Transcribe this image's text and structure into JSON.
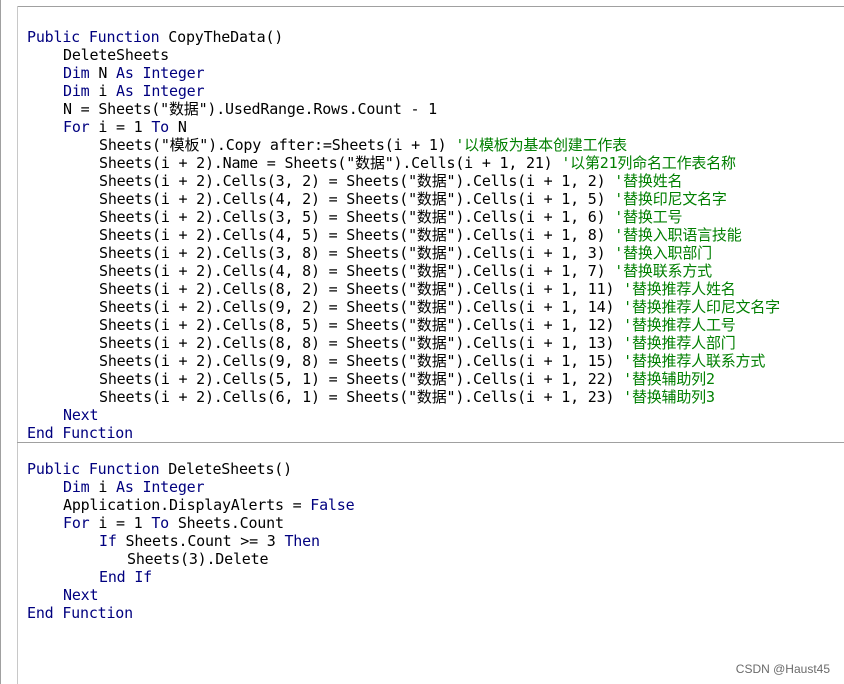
{
  "editor": {
    "procedures": [
      {
        "lines": [
          {
            "indent": 0,
            "segments": [
              {
                "t": "Public Function",
                "k": "kw"
              },
              {
                "t": " CopyTheData()",
                "k": "tx"
              }
            ]
          },
          {
            "indent": 1,
            "segments": [
              {
                "t": "DeleteSheets",
                "k": "tx"
              }
            ]
          },
          {
            "indent": 1,
            "segments": [
              {
                "t": "Dim",
                "k": "kw"
              },
              {
                "t": " N ",
                "k": "tx"
              },
              {
                "t": "As Integer",
                "k": "kw"
              }
            ]
          },
          {
            "indent": 1,
            "segments": [
              {
                "t": "Dim",
                "k": "kw"
              },
              {
                "t": " i ",
                "k": "tx"
              },
              {
                "t": "As Integer",
                "k": "kw"
              }
            ]
          },
          {
            "indent": 1,
            "segments": [
              {
                "t": "N = Sheets(\"数据\").UsedRange.Rows.Count - 1",
                "k": "tx"
              }
            ]
          },
          {
            "indent": 1,
            "segments": [
              {
                "t": "For",
                "k": "kw"
              },
              {
                "t": " i = 1 ",
                "k": "tx"
              },
              {
                "t": "To",
                "k": "kw"
              },
              {
                "t": " N",
                "k": "tx"
              }
            ]
          },
          {
            "indent": 2,
            "segments": [
              {
                "t": "Sheets(\"模板\").Copy after:=Sheets(i + 1) ",
                "k": "tx"
              },
              {
                "t": "'以模板为基本创建工作表",
                "k": "cm"
              }
            ]
          },
          {
            "indent": 2,
            "segments": [
              {
                "t": "Sheets(i + 2).Name = Sheets(\"数据\").Cells(i + 1, 21) ",
                "k": "tx"
              },
              {
                "t": "'以第21列命名工作表名称",
                "k": "cm"
              }
            ]
          },
          {
            "indent": 2,
            "segments": [
              {
                "t": "Sheets(i + 2).Cells(3, 2) = Sheets(\"数据\").Cells(i + 1, 2) ",
                "k": "tx"
              },
              {
                "t": "'替换姓名",
                "k": "cm"
              }
            ]
          },
          {
            "indent": 2,
            "segments": [
              {
                "t": "Sheets(i + 2).Cells(4, 2) = Sheets(\"数据\").Cells(i + 1, 5) ",
                "k": "tx"
              },
              {
                "t": "'替换印尼文名字",
                "k": "cm"
              }
            ]
          },
          {
            "indent": 2,
            "segments": [
              {
                "t": "Sheets(i + 2).Cells(3, 5) = Sheets(\"数据\").Cells(i + 1, 6) ",
                "k": "tx"
              },
              {
                "t": "'替换工号",
                "k": "cm"
              }
            ]
          },
          {
            "indent": 2,
            "segments": [
              {
                "t": "Sheets(i + 2).Cells(4, 5) = Sheets(\"数据\").Cells(i + 1, 8) ",
                "k": "tx"
              },
              {
                "t": "'替换入职语言技能",
                "k": "cm"
              }
            ]
          },
          {
            "indent": 2,
            "segments": [
              {
                "t": "Sheets(i + 2).Cells(3, 8) = Sheets(\"数据\").Cells(i + 1, 3) ",
                "k": "tx"
              },
              {
                "t": "'替换入职部门",
                "k": "cm"
              }
            ]
          },
          {
            "indent": 2,
            "segments": [
              {
                "t": "Sheets(i + 2).Cells(4, 8) = Sheets(\"数据\").Cells(i + 1, 7) ",
                "k": "tx"
              },
              {
                "t": "'替换联系方式",
                "k": "cm"
              }
            ]
          },
          {
            "indent": 2,
            "segments": [
              {
                "t": "Sheets(i + 2).Cells(8, 2) = Sheets(\"数据\").Cells(i + 1, 11) ",
                "k": "tx"
              },
              {
                "t": "'替换推荐人姓名",
                "k": "cm"
              }
            ]
          },
          {
            "indent": 2,
            "segments": [
              {
                "t": "Sheets(i + 2).Cells(9, 2) = Sheets(\"数据\").Cells(i + 1, 14) ",
                "k": "tx"
              },
              {
                "t": "'替换推荐人印尼文名字",
                "k": "cm"
              }
            ]
          },
          {
            "indent": 2,
            "segments": [
              {
                "t": "Sheets(i + 2).Cells(8, 5) = Sheets(\"数据\").Cells(i + 1, 12) ",
                "k": "tx"
              },
              {
                "t": "'替换推荐人工号",
                "k": "cm"
              }
            ]
          },
          {
            "indent": 2,
            "segments": [
              {
                "t": "Sheets(i + 2).Cells(8, 8) = Sheets(\"数据\").Cells(i + 1, 13) ",
                "k": "tx"
              },
              {
                "t": "'替换推荐人部门",
                "k": "cm"
              }
            ]
          },
          {
            "indent": 2,
            "segments": [
              {
                "t": "Sheets(i + 2).Cells(9, 8) = Sheets(\"数据\").Cells(i + 1, 15) ",
                "k": "tx"
              },
              {
                "t": "'替换推荐人联系方式",
                "k": "cm"
              }
            ]
          },
          {
            "indent": 2,
            "segments": [
              {
                "t": "Sheets(i + 2).Cells(5, 1) = Sheets(\"数据\").Cells(i + 1, 22) ",
                "k": "tx"
              },
              {
                "t": "'替换辅助列2",
                "k": "cm"
              }
            ]
          },
          {
            "indent": 2,
            "segments": [
              {
                "t": "Sheets(i + 2).Cells(6, 1) = Sheets(\"数据\").Cells(i + 1, 23) ",
                "k": "tx"
              },
              {
                "t": "'替换辅助列3",
                "k": "cm"
              }
            ]
          },
          {
            "indent": 1,
            "segments": [
              {
                "t": "Next",
                "k": "kw"
              }
            ]
          },
          {
            "indent": 0,
            "segments": [
              {
                "t": "End Function",
                "k": "kw"
              }
            ]
          }
        ]
      },
      {
        "lines": [
          {
            "indent": 0,
            "segments": [
              {
                "t": "Public Function",
                "k": "kw"
              },
              {
                "t": " DeleteSheets()",
                "k": "tx"
              }
            ]
          },
          {
            "indent": 1,
            "segments": [
              {
                "t": "Dim",
                "k": "kw"
              },
              {
                "t": " i ",
                "k": "tx"
              },
              {
                "t": "As Integer",
                "k": "kw"
              }
            ]
          },
          {
            "indent": 1,
            "segments": [
              {
                "t": "Application.DisplayAlerts = ",
                "k": "tx"
              },
              {
                "t": "False",
                "k": "kw"
              }
            ]
          },
          {
            "indent": 1,
            "segments": [
              {
                "t": "For",
                "k": "kw"
              },
              {
                "t": " i = 1 ",
                "k": "tx"
              },
              {
                "t": "To",
                "k": "kw"
              },
              {
                "t": " Sheets.Count",
                "k": "tx"
              }
            ]
          },
          {
            "indent": 2,
            "segments": [
              {
                "t": "If",
                "k": "kw"
              },
              {
                "t": " Sheets.Count >= 3 ",
                "k": "tx"
              },
              {
                "t": "Then",
                "k": "kw"
              }
            ]
          },
          {
            "indent": 3,
            "segments": [
              {
                "t": "Sheets(3).Delete",
                "k": "tx"
              }
            ]
          },
          {
            "indent": 2,
            "segments": [
              {
                "t": "End If",
                "k": "kw"
              }
            ]
          },
          {
            "indent": 1,
            "segments": [
              {
                "t": "Next",
                "k": "kw"
              }
            ]
          },
          {
            "indent": 0,
            "segments": [
              {
                "t": "End Function",
                "k": "kw"
              }
            ]
          }
        ]
      }
    ]
  },
  "watermark": "CSDN @Haust45",
  "colors": {
    "keyword": "#00007f",
    "comment": "#007f00",
    "text": "#000000"
  }
}
